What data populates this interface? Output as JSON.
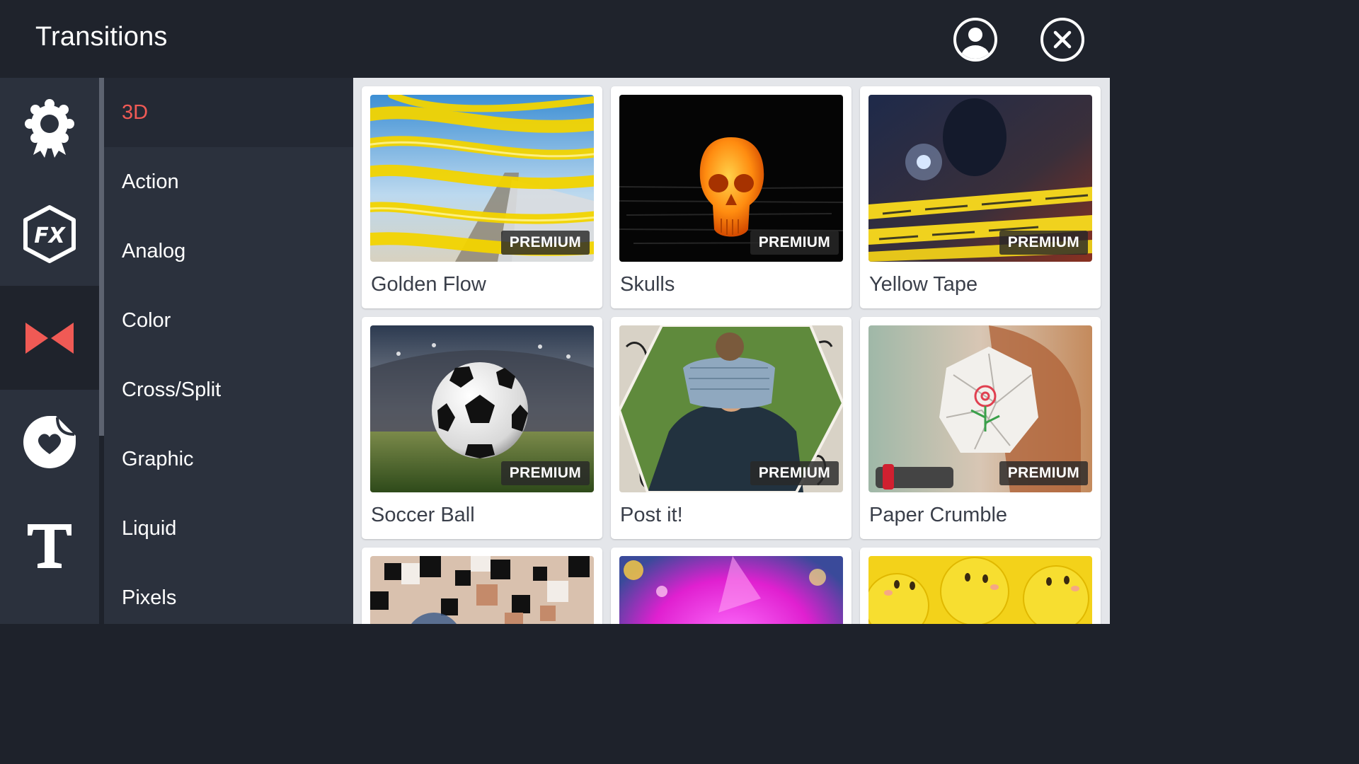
{
  "header": {
    "title": "Transitions"
  },
  "rail": {
    "items": [
      {
        "name": "badge-icon",
        "active": false
      },
      {
        "name": "fx-icon",
        "active": false
      },
      {
        "name": "bowtie-icon",
        "active": true
      },
      {
        "name": "sticker-heart-icon",
        "active": false
      },
      {
        "name": "text-icon",
        "active": false
      }
    ]
  },
  "categories": {
    "items": [
      {
        "label": "3D",
        "active": true
      },
      {
        "label": "Action"
      },
      {
        "label": "Analog"
      },
      {
        "label": "Color"
      },
      {
        "label": "Cross/Split"
      },
      {
        "label": "Graphic"
      },
      {
        "label": "Liquid"
      },
      {
        "label": "Pixels"
      }
    ]
  },
  "cards": [
    {
      "title": "Golden Flow",
      "badge": "PREMIUM"
    },
    {
      "title": "Skulls",
      "badge": "PREMIUM"
    },
    {
      "title": "Yellow Tape",
      "badge": "PREMIUM"
    },
    {
      "title": "Soccer Ball",
      "badge": "PREMIUM"
    },
    {
      "title": "Post it!",
      "badge": "PREMIUM"
    },
    {
      "title": "Paper Crumble",
      "badge": "PREMIUM"
    },
    {
      "title": ""
    },
    {
      "title": ""
    },
    {
      "title": ""
    }
  ],
  "colors": {
    "accent": "#f05a55",
    "header_bg": "#1f232c",
    "panel_bg": "#2b313d",
    "grid_bg": "#e4e6ea"
  }
}
